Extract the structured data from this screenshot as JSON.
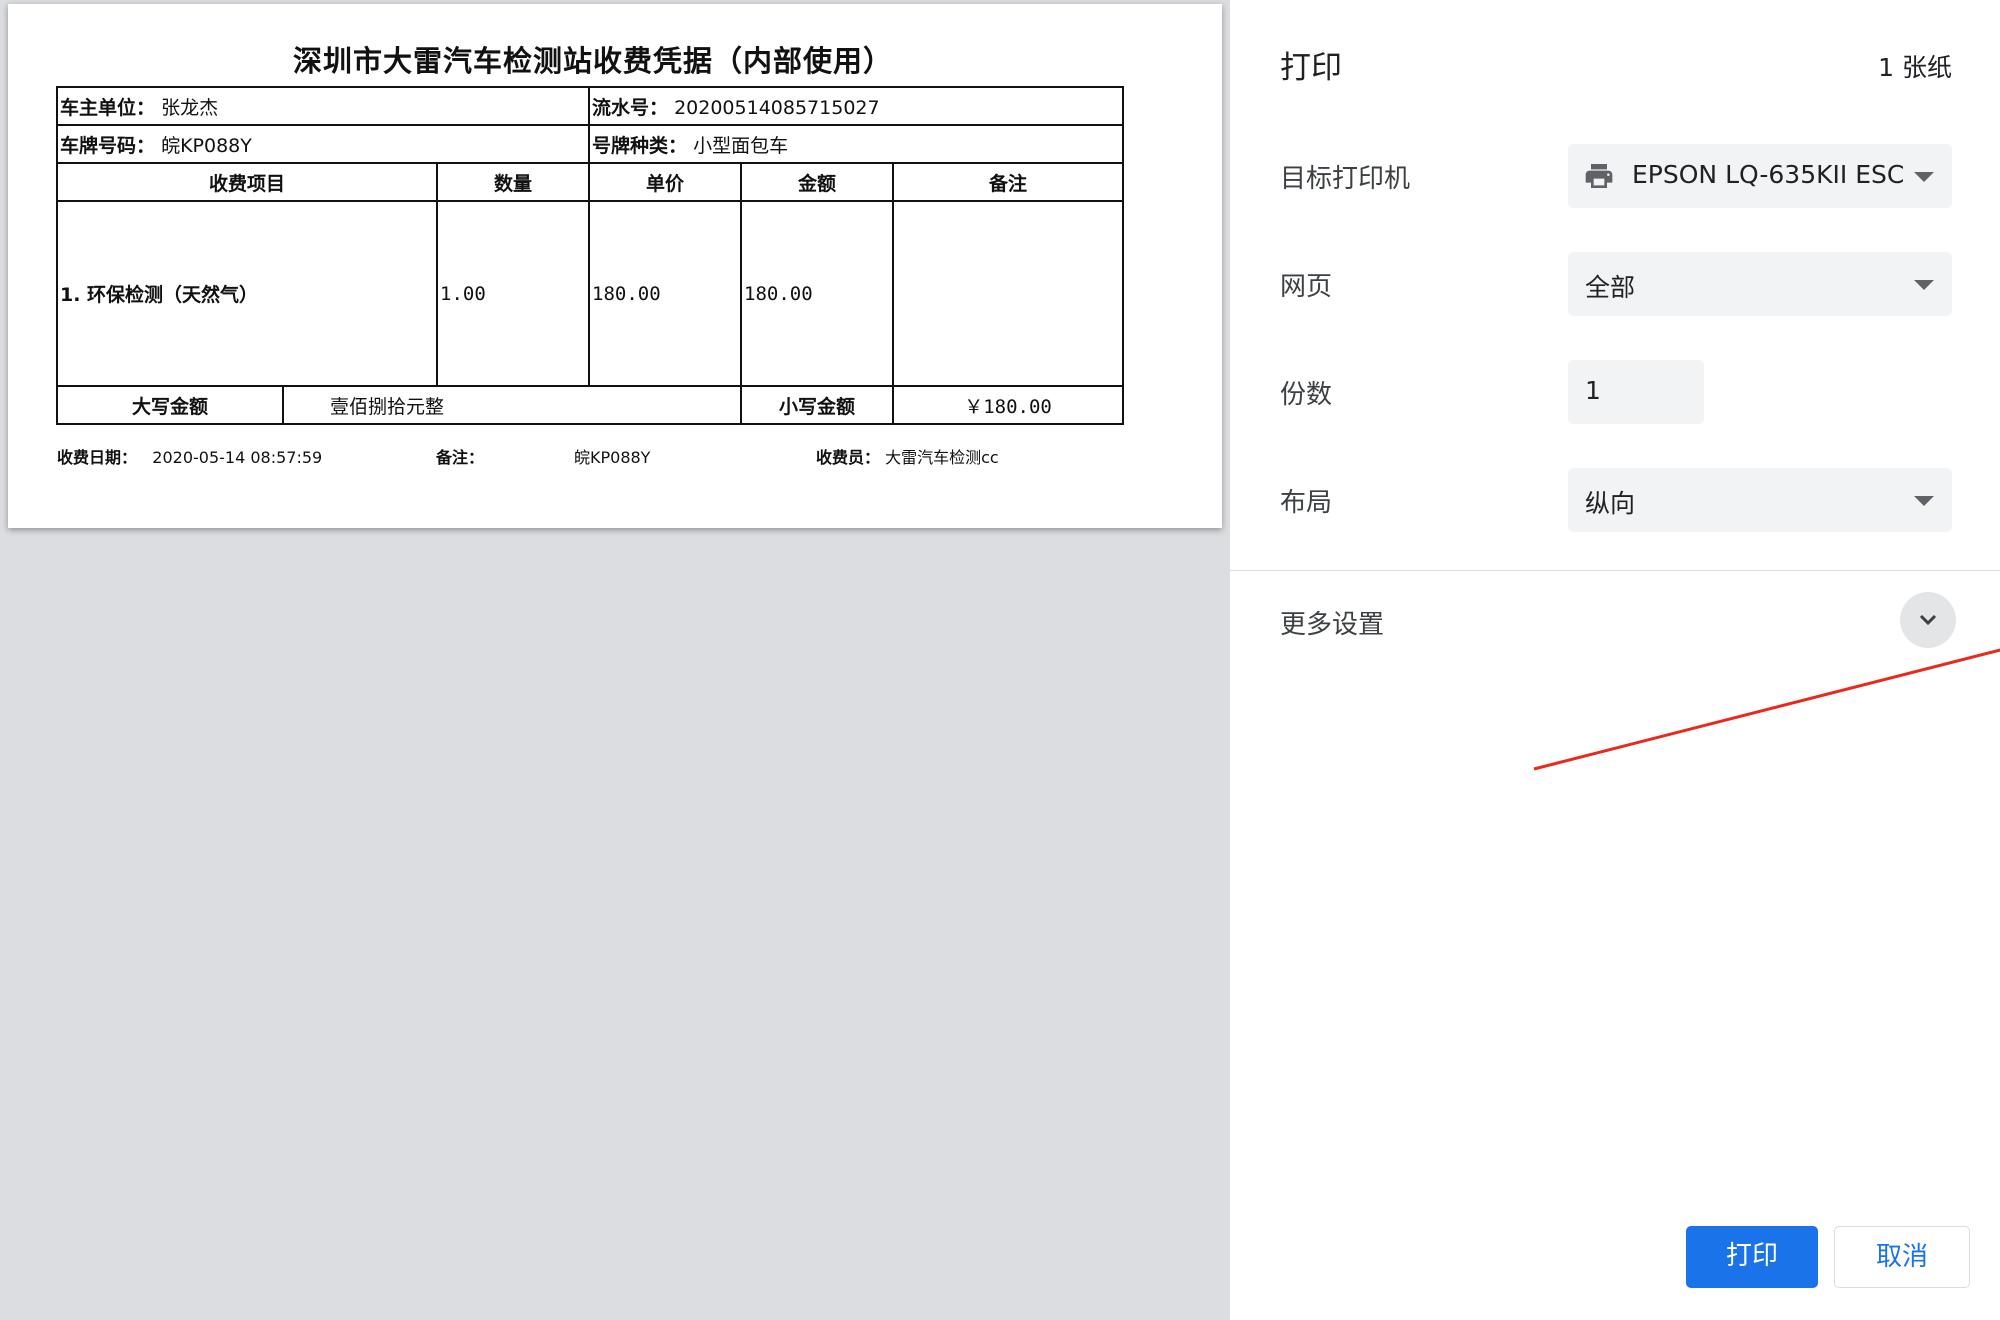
{
  "receipt": {
    "title": "深圳市大雷汽车检测站收费凭据（内部使用）",
    "owner_label": "车主单位：",
    "owner_value": "张龙杰",
    "serial_label": "流水号：",
    "serial_value": "20200514085715027",
    "plate_label": "车牌号码：",
    "plate_value": "皖KP088Y",
    "plate_type_label": "号牌种类：",
    "plate_type_value": "小型面包车",
    "headers": [
      "收费项目",
      "数量",
      "单价",
      "金额",
      "备注"
    ],
    "item": {
      "name": "1.  环保检测（天然气）",
      "qty": "1.00",
      "unit_price": "180.00",
      "amount": "180.00",
      "remark": ""
    },
    "upper_amount_label": "大写金额",
    "upper_amount_value": "壹佰捌拾元整",
    "lower_amount_label": "小写金额",
    "lower_amount_value": "￥180.00",
    "date_label": "收费日期：",
    "date_value": "2020-05-14 08:57:59",
    "remark_label": "备注：",
    "remark_value": "皖KP088Y",
    "cashier_label": "收费员：",
    "cashier_value": "大雷汽车检测cc"
  },
  "panel": {
    "title": "打印",
    "sheet_count": "1 张纸",
    "printer_label": "目标打印机",
    "printer_value": "EPSON LQ-635KII ESC",
    "pages_label": "网页",
    "pages_value": "全部",
    "copies_label": "份数",
    "copies_value": "1",
    "layout_label": "布局",
    "layout_value": "纵向",
    "more_settings_label": "更多设置",
    "print_button": "打印",
    "cancel_button": "取消"
  },
  "colors": {
    "accent": "#1a73e8",
    "annotation_arrow": "#e8291c",
    "preview_bg": "#dcdde0"
  }
}
